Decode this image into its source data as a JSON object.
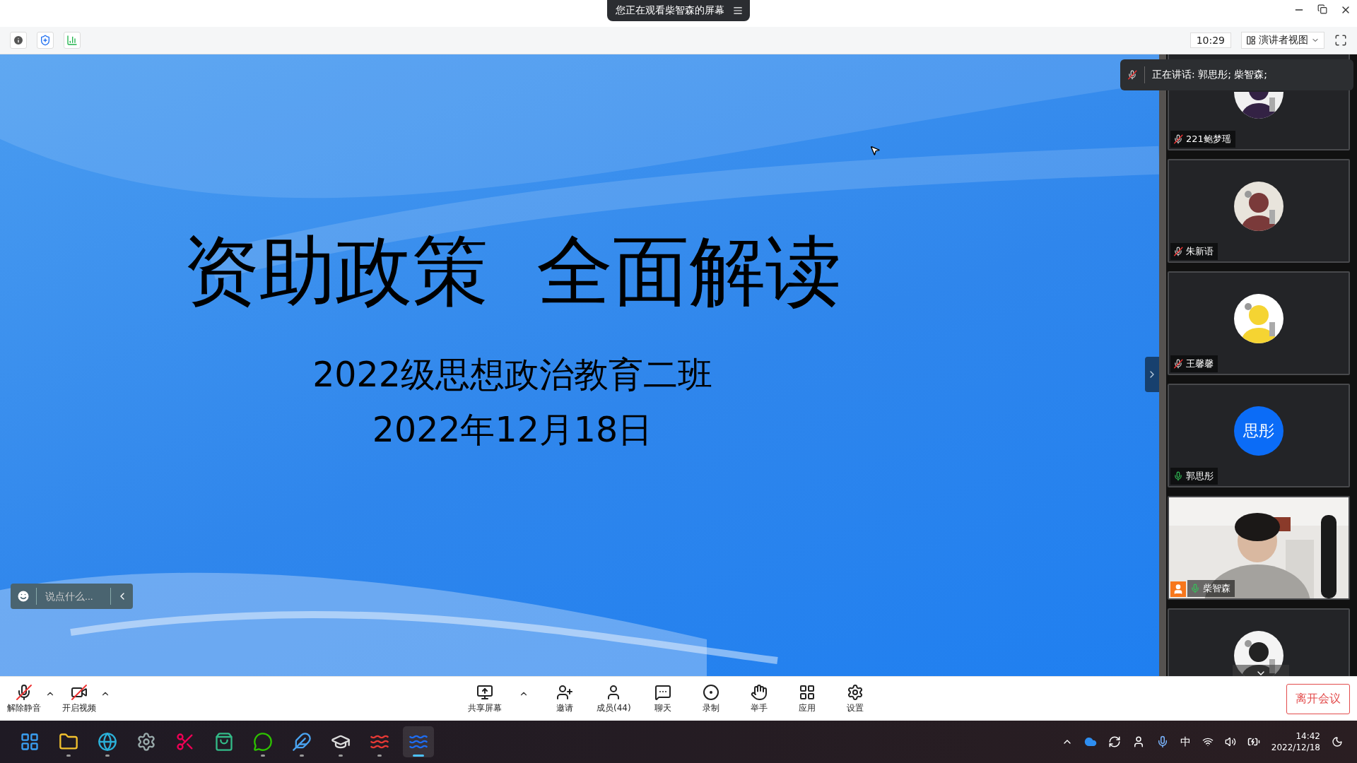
{
  "title_bar": {
    "banner": "您正在观看柴智森的屏幕"
  },
  "meeting_bar": {
    "timer": "10:29",
    "view_menu": "演讲者视图"
  },
  "slide": {
    "title": "资助政策  全面解读",
    "subtitle": "2022级思想政治教育二班",
    "date": "2022年12月18日"
  },
  "chat_box": {
    "placeholder": "说点什么..."
  },
  "speaking": {
    "text": "正在讲话: 郭思彤; 柴智森;",
    "muted": true
  },
  "participants": [
    {
      "kind": "avatar",
      "name": "221鲍梦瑶",
      "muted": true,
      "host": false
    },
    {
      "kind": "avatar",
      "name": "朱新语",
      "muted": true,
      "host": false
    },
    {
      "kind": "avatar",
      "name": "王馨馨",
      "muted": true,
      "host": false
    },
    {
      "kind": "initials",
      "initials": "思彤",
      "name": "郭思彤",
      "muted": false,
      "host": false
    },
    {
      "kind": "video",
      "name": "柴智森",
      "muted": false,
      "host": true
    },
    {
      "kind": "avatar"
    }
  ],
  "toolbar": {
    "items": [
      {
        "label": "解除静音",
        "off": true,
        "menu": true
      },
      {
        "label": "开启视频",
        "off": true,
        "menu": true
      },
      {
        "label": "共享屏幕",
        "off": false,
        "menu": true
      },
      {
        "label": "邀请",
        "off": false,
        "menu": false
      },
      {
        "label": "成员(44)",
        "off": false,
        "menu": false
      },
      {
        "label": "聊天",
        "off": false,
        "menu": false
      },
      {
        "label": "录制",
        "off": false,
        "menu": false
      },
      {
        "label": "举手",
        "off": false,
        "menu": false
      },
      {
        "label": "应用",
        "off": false,
        "menu": false
      },
      {
        "label": "设置",
        "off": false,
        "menu": false
      }
    ],
    "leave": "离开会议"
  },
  "taskbar": {
    "apps": [
      {
        "running": false,
        "selected": false
      },
      {
        "running": true,
        "selected": false
      },
      {
        "running": true,
        "selected": false
      },
      {
        "running": false,
        "selected": false
      },
      {
        "running": false,
        "selected": false
      },
      {
        "running": false,
        "selected": false
      },
      {
        "running": true,
        "selected": false
      },
      {
        "running": true,
        "selected": false
      },
      {
        "running": true,
        "selected": false
      },
      {
        "running": true,
        "selected": false
      },
      {
        "running": true,
        "selected": true
      }
    ],
    "tray": {
      "input": "中",
      "time": "14:42",
      "date": "2022/12/18"
    }
  }
}
